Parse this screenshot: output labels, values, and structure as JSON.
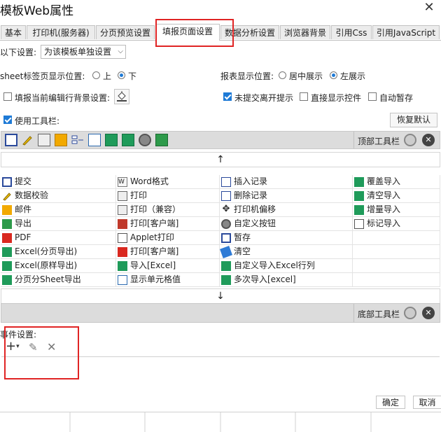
{
  "window": {
    "title": "模板Web属性"
  },
  "tabs": [
    {
      "label": "基本"
    },
    {
      "label": "打印机(服务器)"
    },
    {
      "label": "分页预览设置"
    },
    {
      "label": "填报页面设置"
    },
    {
      "label": "数据分析设置"
    },
    {
      "label": "浏览器背景"
    },
    {
      "label": "引用Css"
    },
    {
      "label": "引用JavaScript"
    }
  ],
  "settings": {
    "scope_label": "以下设置:",
    "scope_value": "为该模板单独设置",
    "sheet_pos_label": "sheet标签页显示位置:",
    "sheet_top": "上",
    "sheet_bottom": "下",
    "report_pos_label": "报表显示位置:",
    "report_center": "居中展示",
    "report_left": "左展示",
    "fill_bg_label": "填报当前编辑行背景设置:",
    "unsubmitted_prompt": "未提交离开提示",
    "direct_show_ctrl": "直接显示控件",
    "auto_save": "自动暂存",
    "use_toolbar": "使用工具栏:",
    "restore_default": "恢复默认",
    "top_toolbar": "顶部工具栏",
    "bottom_toolbar": "底部工具栏",
    "up_arrow": "↑",
    "down_arrow": "↓"
  },
  "buttons_grid": [
    [
      "提交",
      "Word格式",
      "插入记录",
      "覆盖导入"
    ],
    [
      "数据校验",
      "打印",
      "删除记录",
      "清空导入"
    ],
    [
      "邮件",
      "打印（兼容）",
      "打印机偏移",
      "增量导入"
    ],
    [
      "导出",
      "打印[客户端]",
      "自定义按钮",
      "标记导入"
    ],
    [
      "PDF",
      "Applet打印",
      "暂存",
      ""
    ],
    [
      "Excel(分页导出)",
      "打印[客户端]",
      "清空",
      ""
    ],
    [
      "Excel(原样导出)",
      "导入[Excel]",
      "自定义导入Excel行列",
      ""
    ],
    [
      "分页分Sheet导出",
      "显示单元格值",
      "多次导入[excel]",
      ""
    ]
  ],
  "events": {
    "label": "事件设置:"
  },
  "footer": {
    "ok": "确定",
    "cancel": "取消"
  },
  "colors": {
    "accent": "#1e7ad6",
    "highlight_box": "#e02424",
    "band": "#dcdcdc"
  }
}
